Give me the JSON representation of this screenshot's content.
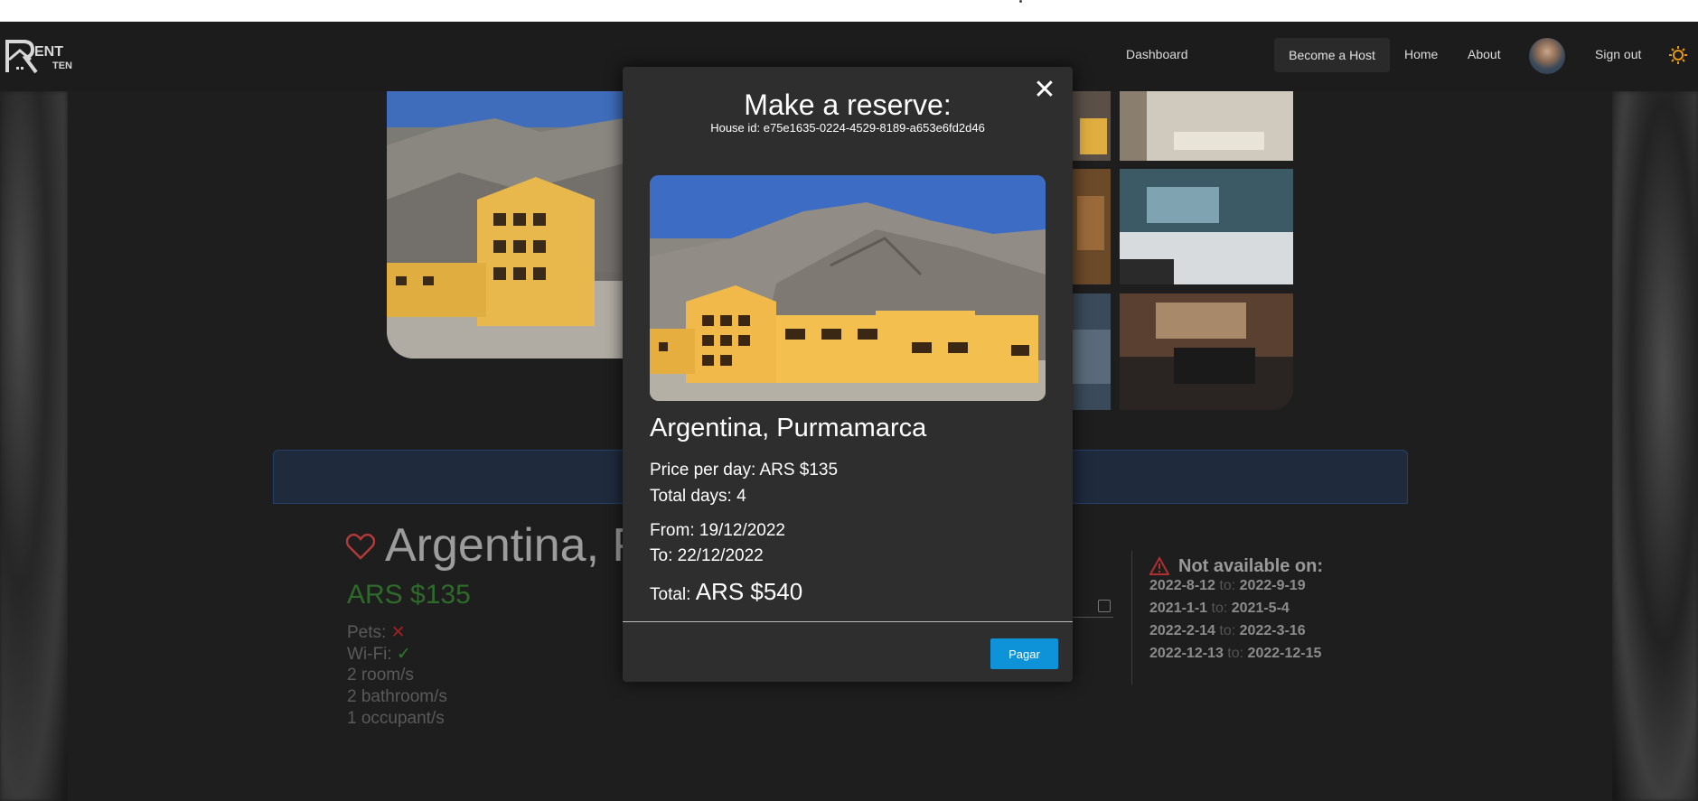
{
  "navbar": {
    "logo_text_top": "ENT",
    "logo_text_bottom": "TEN",
    "dashboard": "Dashboard",
    "become_host": "Become a Host",
    "home": "Home",
    "about": "About",
    "sign_out": "Sign out"
  },
  "listing": {
    "title": "Argentina, P",
    "price": "ARS $135",
    "pets_label": "Pets:",
    "wifi_label": "Wi-Fi:",
    "rooms": "2 room/s",
    "bathrooms": "2 bathroom/s",
    "occupants": "1 occupant/s",
    "partial_label": ":"
  },
  "not_available": {
    "title": "Not available on:",
    "to_word": "to:",
    "ranges": [
      {
        "from": "2022-8-12",
        "to": "2022-9-19"
      },
      {
        "from": "2021-1-1",
        "to": "2021-5-4"
      },
      {
        "from": "2022-2-14",
        "to": "2022-3-16"
      },
      {
        "from": "2022-12-13",
        "to": "2022-12-15"
      }
    ]
  },
  "modal": {
    "title": "Make a reserve:",
    "house_id": "House id: e75e1635-0224-4529-8189-a653e6fd2d46",
    "place": "Argentina, Purmamarca",
    "price_per_day": "Price per day: ARS $135",
    "total_days": "Total days: 4",
    "from": "From: 19/12/2022",
    "to": "To: 22/12/2022",
    "total_label": "Total:",
    "total_value": "ARS $540",
    "pay_button": "Pagar",
    "close_symbol": "✕"
  },
  "colors": {
    "pay_button": "#0f93d8",
    "price_green": "#2e6b2a",
    "warning_red": "#b03030",
    "sun_icon": "#e89b12"
  }
}
